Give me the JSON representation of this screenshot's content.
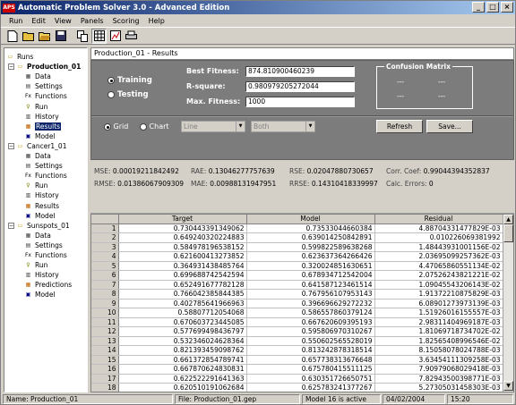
{
  "window": {
    "title": "Automatic Problem Solver 3.0 - Advanced Edition",
    "icon_text": "APS"
  },
  "menu": [
    "Run",
    "Edit",
    "View",
    "Panels",
    "Scoring",
    "Help"
  ],
  "toolbar": [
    "new-icon",
    "open-icon",
    "folder-icon",
    "save-icon",
    "copy-icon",
    "grid-icon",
    "chart-icon",
    "print-icon"
  ],
  "tree": {
    "root": "Runs",
    "runs": [
      {
        "name": "Production_01",
        "bold": true,
        "items": [
          "Data",
          "Settings",
          "Functions",
          "Run",
          "History",
          "Results",
          "Model"
        ],
        "selected": "Results"
      },
      {
        "name": "Cancer1_01",
        "bold": false,
        "items": [
          "Data",
          "Settings",
          "Functions",
          "Run",
          "History",
          "Results",
          "Model"
        ]
      },
      {
        "name": "Sunspots_01",
        "bold": false,
        "items": [
          "Data",
          "Settings",
          "Functions",
          "Run",
          "History",
          "Predictions",
          "Model"
        ]
      }
    ]
  },
  "main": {
    "header": "Production_01 - Results",
    "dataset_training": "Training",
    "dataset_testing": "Testing",
    "best_fitness_label": "Best Fitness:",
    "best_fitness": "874.810900460239",
    "rsquare_label": "R-square:",
    "rsquare": "0.980979205272044",
    "max_fitness_label": "Max. Fitness:",
    "max_fitness": "1000",
    "confusion_title": "Confusion Matrix",
    "confusion_cells": [
      "---",
      "---",
      "---",
      "---"
    ],
    "view_grid": "Grid",
    "view_chart": "Chart",
    "combo_line": "Line",
    "combo_both": "Both",
    "refresh": "Refresh",
    "save": "Save..."
  },
  "stats": {
    "mse_label": "MSE:",
    "mse": "0.00019211842492",
    "rae_label": "RAE:",
    "rae": "0.13046277757639",
    "rse_label": "RSE:",
    "rse": "0.02047880730657",
    "corr_label": "Corr. Coef:",
    "corr": "0.99044394352837",
    "rmse_label": "RMSE:",
    "rmse": "0.01386067909309",
    "mae_label": "MAE:",
    "mae": "0.00988131947951",
    "rrse_label": "RRSE:",
    "rrse": "0.14310418339997",
    "calc_label": "Calc. Errors:",
    "calc": "0"
  },
  "table": {
    "headers": [
      "Target",
      "Model",
      "Residual"
    ],
    "rows": [
      [
        "1",
        "0.730443391349062",
        "0.73533044660384",
        "4.88704331477829E-03"
      ],
      [
        "2",
        "0.649240320224883",
        "0.639014250842891",
        "0.010226069381992"
      ],
      [
        "3",
        "0.584978196538152",
        "0.599822589638268",
        "1.48443931001156E-02"
      ],
      [
        "4",
        "0.621600413273852",
        "0.623637364266426",
        "2.03695099257362E-03"
      ],
      [
        "5",
        "0.364931438485764",
        "0.320024851630651",
        "4.47065860551134E-02"
      ],
      [
        "6",
        "0.699688742542594",
        "0.678934712542004",
        "2.07526243821221E-02"
      ],
      [
        "7",
        "0.652491677782128",
        "0.641587123461514",
        "1.09045543206143E-02"
      ],
      [
        "8",
        "0.766042385844385",
        "0.767956107953143",
        "1.91372210875829E-03"
      ],
      [
        "9",
        "0.402785641966963",
        "0.396696629272232",
        "6.08901273973139E-03"
      ],
      [
        "10",
        "0.58807712054068",
        "0.586557860379124",
        "1.51926016155557E-03"
      ],
      [
        "11",
        "0.670603723445085",
        "0.667620609395193",
        "2.98311404969187E-03"
      ],
      [
        "12",
        "0.577699498436797",
        "0.595806970310267",
        "1.81069718734702E-02"
      ],
      [
        "13",
        "0.532346024628364",
        "0.550602565528019",
        "1.82565408996546E-02"
      ],
      [
        "14",
        "0.821393459098762",
        "0.813242878318514",
        "8.15058078024788E-03"
      ],
      [
        "15",
        "0.661372854789741",
        "0.657738313676648",
        "3.63454111309258E-03"
      ],
      [
        "16",
        "0.667870624830831",
        "0.675780415511125",
        "7.90979068029418E-03"
      ],
      [
        "17",
        "0.622522291641363",
        "0.630351726650751",
        "7.82943500398771E-03"
      ],
      [
        "18",
        "0.620510191062684",
        "0.625783241377267",
        "5.27305031458303E-03"
      ],
      [
        "19",
        "0.533213870216213",
        "0.552768681972781",
        "1.93648117565683E-02"
      ],
      [
        "20",
        "0.556781159407905",
        "0.576371833965307",
        "1.95906745574024E-02"
      ],
      [
        "21",
        "0.641215412253433",
        "0.645071601647605",
        "3.85618039417202E-03"
      ]
    ]
  },
  "status": {
    "name": "Name: Production_01",
    "file": "File: Production_01.gep",
    "model": "Model 16 is active",
    "date": "04/02/2004",
    "time": "15:20"
  }
}
